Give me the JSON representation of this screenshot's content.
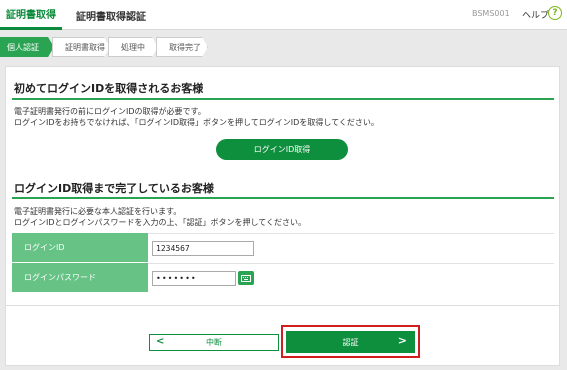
{
  "header": {
    "tab": "証明書取得",
    "title": "証明書取得認証",
    "screen_id": "BSMS001",
    "help_label": "ヘルプ",
    "help_icon": "?"
  },
  "steps": [
    "個人認証",
    "証明書取得",
    "処理中",
    "取得完了"
  ],
  "section1": {
    "title": "初めてログインIDを取得されるお客様",
    "line1": "電子証明書発行の前にログインIDの取得が必要です。",
    "line2": "ログインIDをお持ちでなければ、「ログインID取得」ボタンを押してログインIDを取得してください。",
    "button": "ログインID取得"
  },
  "section2": {
    "title": "ログインID取得まで完了しているお客様",
    "line1": "電子証明書発行に必要な本人認証を行います。",
    "line2": "ログインIDとログインパスワードを入力の上、「認証」ボタンを押してください。",
    "login_id_label": "ログインID",
    "login_id_value": "1234567",
    "password_label": "ログインパスワード",
    "password_value": "•••••••"
  },
  "actions": {
    "cancel": "中断",
    "auth": "認証"
  },
  "colors": {
    "accent": "#0e8f3e",
    "label_bg": "#66c285",
    "highlight": "#d01e1e"
  }
}
